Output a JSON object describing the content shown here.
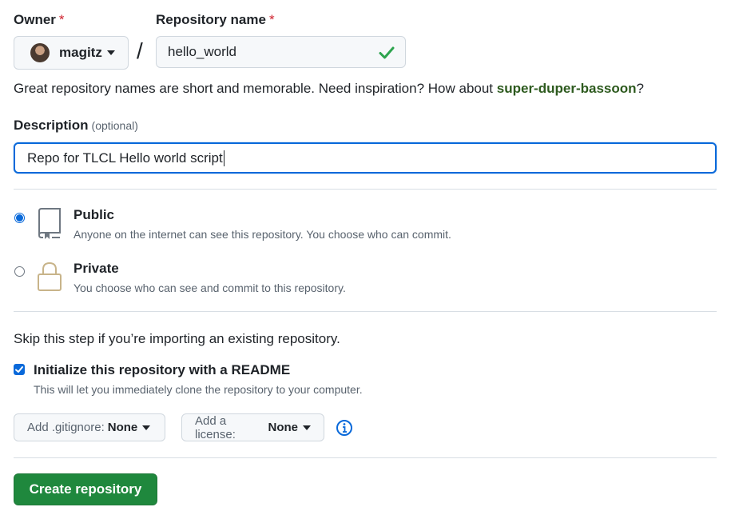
{
  "owner": {
    "label": "Owner",
    "required_mark": "*",
    "name": "magitz"
  },
  "repo": {
    "label": "Repository name",
    "required_mark": "*",
    "value": "hello_world",
    "separator": "/"
  },
  "hint": {
    "text": "Great repository names are short and memorable. Need inspiration? How about ",
    "suggestion": "super-duper-bassoon",
    "suffix": "?"
  },
  "description": {
    "label": "Description",
    "optional": "(optional)",
    "value": "Repo for TLCL Hello world script"
  },
  "visibility": {
    "public": {
      "title": "Public",
      "desc": "Anyone on the internet can see this repository. You choose who can commit.",
      "selected": true
    },
    "private": {
      "title": "Private",
      "desc": "You choose who can see and commit to this repository.",
      "selected": false
    }
  },
  "init": {
    "skip_text": "Skip this step if you’re importing an existing repository.",
    "readme_title": "Initialize this repository with a README",
    "readme_desc": "This will let you immediately clone the repository to your computer.",
    "readme_checked": true,
    "gitignore_label": "Add .gitignore:",
    "gitignore_value": "None",
    "license_label": "Add a license:",
    "license_value": "None"
  },
  "create_label": "Create repository",
  "colors": {
    "accent": "#0969da",
    "success": "#1f883d",
    "check": "#2da44e",
    "suggestion": "#2d5a1e"
  }
}
